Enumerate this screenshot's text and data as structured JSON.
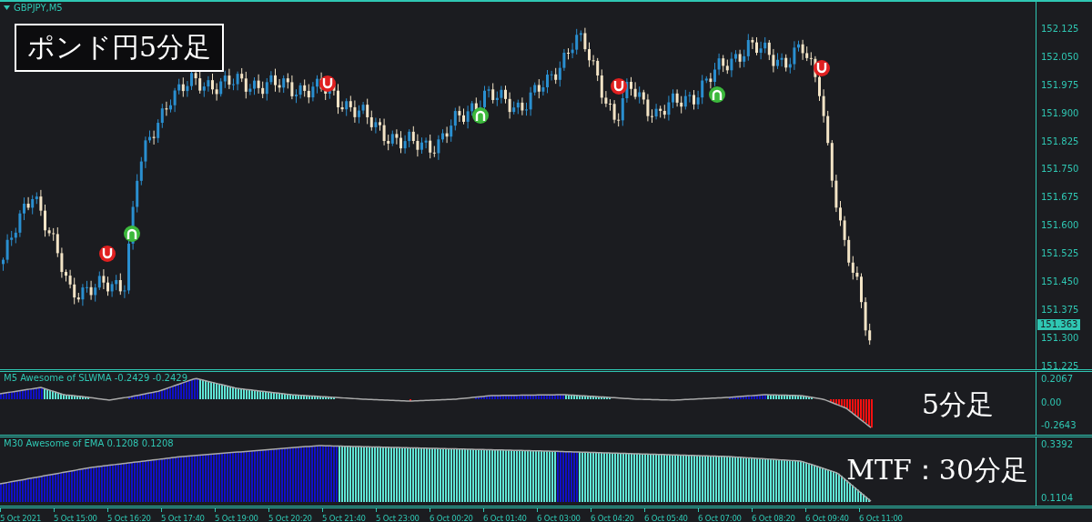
{
  "chart": {
    "symbol": "GBPJPY,M5",
    "overlay_title": "ポンド円5分足"
  },
  "price_axis": {
    "labels": [
      "152.125",
      "152.050",
      "151.975",
      "151.900",
      "151.825",
      "151.750",
      "151.675",
      "151.600",
      "151.525",
      "151.450",
      "151.375",
      "151.300",
      "151.225"
    ],
    "current_price": "151.363"
  },
  "indicators": [
    {
      "kind": "oscillator",
      "label": "M5 Awesome of SLWMA -0.2429 -0.2429",
      "axis_labels": [
        "0.2067",
        "0.00",
        "-0.2643"
      ],
      "caption": "5分足"
    },
    {
      "kind": "mtf",
      "label": "M30 Awesome of EMA 0.1208 0.1208",
      "axis_labels": [
        "0.3392",
        "0.1104"
      ],
      "caption": "MTF：30分足"
    }
  ],
  "time_axis": [
    "5 Oct 2021",
    "5 Oct 15:00",
    "5 Oct 16:20",
    "5 Oct 17:40",
    "5 Oct 19:00",
    "5 Oct 20:20",
    "5 Oct 21:40",
    "5 Oct 23:00",
    "6 Oct 00:20",
    "6 Oct 01:40",
    "6 Oct 03:00",
    "6 Oct 04:20",
    "6 Oct 05:40",
    "6 Oct 07:00",
    "6 Oct 08:20",
    "6 Oct 09:40",
    "6 Oct 11:00"
  ]
}
